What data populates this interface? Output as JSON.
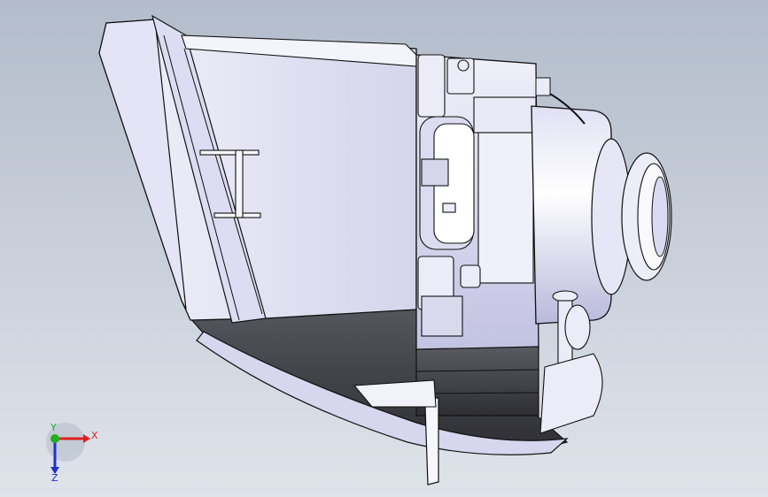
{
  "viewport": {
    "background_top": "#b3bccb",
    "background_bottom": "#dfe3ea"
  },
  "model": {
    "shade_light": "#e8e8f6",
    "shade_mid": "#c9c9e6",
    "shade_dark": "#4a4a52",
    "edge_color": "#1a1a1a"
  },
  "triad": {
    "x_label": "X",
    "y_label": "Y",
    "z_label": "Z",
    "x_color": "#e02020",
    "y_color": "#20b020",
    "z_color": "#2030d0"
  }
}
